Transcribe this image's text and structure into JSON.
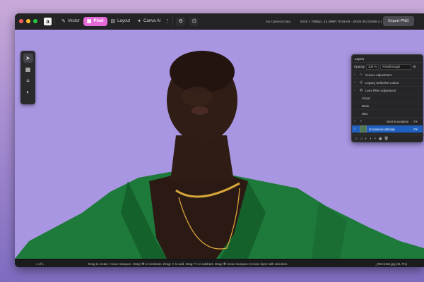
{
  "toolbar": {
    "personas": [
      {
        "label": "Vector",
        "icon": "vector-icon"
      },
      {
        "label": "Pixel",
        "icon": "pixel-icon"
      },
      {
        "label": "Layout",
        "icon": "layout-icon"
      },
      {
        "label": "Canva AI",
        "icon": "sparkle-icon"
      }
    ],
    "active_persona": "Pixel",
    "camera_data": "No Camera Data",
    "doc_info": "5325 × 7988px, 42.39MP, RGBA/8 - sRGB IEC61966-2.1",
    "export_label": "Export PNG"
  },
  "tools": [
    "move-tool-icon",
    "grid-tool-icon",
    "crop-tool-icon",
    "paint-tool-icon"
  ],
  "layers_panel": {
    "title": "Layers",
    "opacity_label": "Opacity",
    "opacity_value": "100 %",
    "blend_mode": "Passthrough",
    "items": [
      {
        "label": "Curves Adjustment"
      },
      {
        "label": "Legacy Selective Colour"
      },
      {
        "label": "Lens Filter Adjustment"
      }
    ],
    "sub_items": [
      "Cloud",
      "Brais",
      "Mist"
    ],
    "pixel_layer_label": "(Container)",
    "pixel_layer_sub": "Bitmap",
    "extra_label": "Nest Ennotation",
    "fx_label": "FX"
  },
  "status": {
    "page": "1 of 1",
    "hint": "Drag to create / move marquee. Drag+⌘ to constrain. Drag+⇧ to add. Drag+⌥ to subtract. Drag+⌘ move marquee to move layer with selection.",
    "file": "_DSC1154.jpg (21.7%)"
  },
  "colors": {
    "accent": "#e46ad8",
    "selection": "#1f5fbf",
    "background": "#a895e0",
    "jacket": "#1f7a3c"
  }
}
